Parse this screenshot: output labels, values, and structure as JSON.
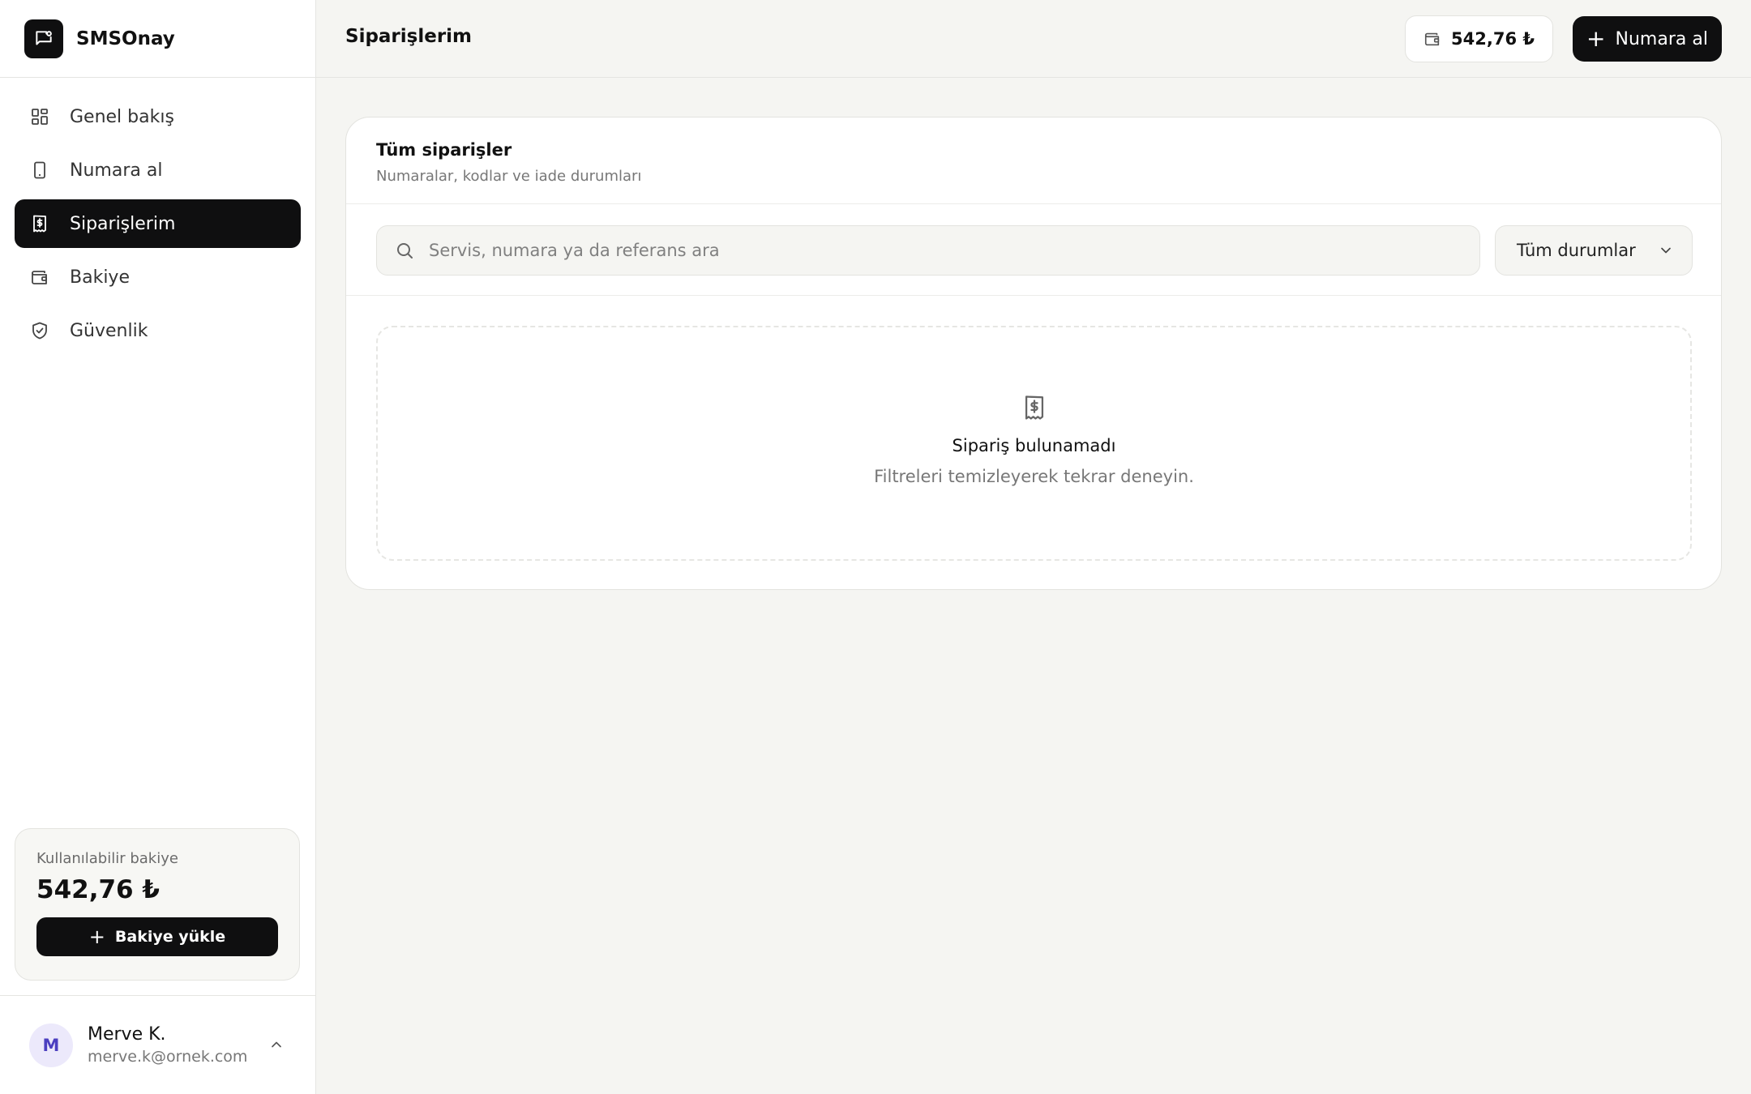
{
  "brand": {
    "name": "SMSOnay"
  },
  "sidebar": {
    "items": [
      {
        "label": "Genel bakış",
        "icon": "dashboard-icon"
      },
      {
        "label": "Numara al",
        "icon": "phone-icon"
      },
      {
        "label": "Siparişlerim",
        "icon": "receipt-icon",
        "active": true
      },
      {
        "label": "Bakiye",
        "icon": "wallet-icon"
      },
      {
        "label": "Güvenlik",
        "icon": "shield-icon"
      }
    ],
    "balance": {
      "caption": "Kullanılabilir bakiye",
      "amount": "542,76 ₺",
      "load_button": "Bakiye yükle"
    },
    "user": {
      "initial": "M",
      "name": "Merve K.",
      "email": "merve.k@ornek.com"
    }
  },
  "header": {
    "title": "Siparişlerim",
    "balance": "542,76 ₺",
    "new_number_button": "Numara al"
  },
  "orders": {
    "title": "Tüm siparişler",
    "subtitle": "Numaralar, kodlar ve iade durumları",
    "search_placeholder": "Servis, numara ya da referans ara",
    "status_filter": "Tüm durumlar",
    "empty_title": "Sipariş bulunamadı",
    "empty_subtitle": "Filtreleri temizleyerek tekrar deneyin."
  },
  "colors": {
    "accent": "#0f0f10",
    "background": "#f5f5f2",
    "avatar_bg": "#ece9fb",
    "avatar_fg": "#4b3fc0"
  }
}
